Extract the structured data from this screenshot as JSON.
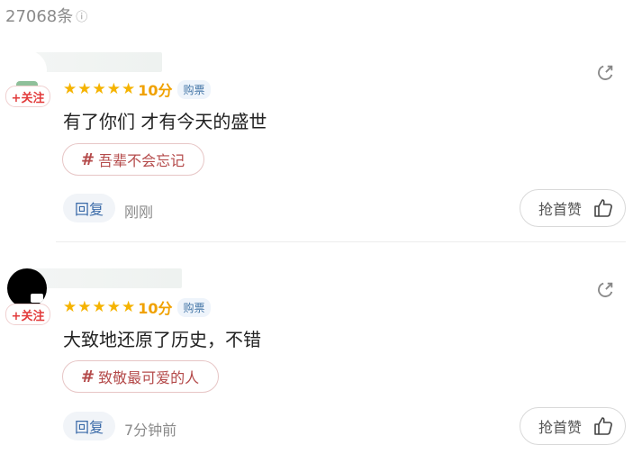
{
  "header": {
    "count": "27068条",
    "info_icon": "info-icon"
  },
  "comments": [
    {
      "follow_label": "+关注",
      "stars": "★★★★★",
      "score": "10分",
      "tag": "购票",
      "text": "有了你们 才有今天的盛世",
      "hashtag": "吾辈不会忘记",
      "reply_label": "回复",
      "time": "刚刚",
      "like_label": "抢首赞"
    },
    {
      "follow_label": "+关注",
      "stars": "★★★★★",
      "score": "10分",
      "tag": "购票",
      "text": "大致地还原了历史，不错",
      "hashtag": "致敬最可爱的人",
      "reply_label": "回复",
      "time": "7分钟前",
      "like_label": "抢首赞"
    }
  ],
  "colors": {
    "star": "#f5b300",
    "follow": "#e23b3b",
    "reply": "#3a6aa8",
    "hashtag": "#b44a4a"
  }
}
